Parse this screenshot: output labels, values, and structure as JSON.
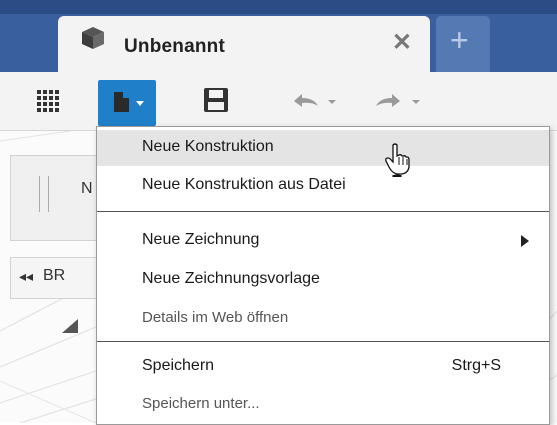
{
  "tab": {
    "title": "Unbenannt",
    "close_label": "✕",
    "icon": "cube-icon"
  },
  "new_tab": {
    "label": "+"
  },
  "toolbar": {
    "icons": [
      "apps-grid-icon",
      "file-menu-icon",
      "save-icon",
      "undo-icon",
      "redo-icon"
    ]
  },
  "workspace": {
    "panel_letter": "N",
    "nav_arrow": "◂◂",
    "nav_label": "BR"
  },
  "menu": {
    "items": [
      {
        "label": "Neue Konstruktion",
        "shortcut": "",
        "submenu": false,
        "hovered": true
      },
      {
        "label": "Neue Konstruktion aus Datei",
        "shortcut": "",
        "submenu": false
      },
      {
        "label": "Neue Zeichnung",
        "shortcut": "",
        "submenu": true
      },
      {
        "label": "Neue Zeichnungsvorlage",
        "shortcut": "",
        "submenu": false
      },
      {
        "label": "Details im Web öffnen",
        "shortcut": "",
        "submenu": false
      },
      {
        "label": "Speichern",
        "shortcut": "Strg+S",
        "submenu": false
      },
      {
        "label": "Speichern unter...",
        "shortcut": "",
        "submenu": false
      }
    ]
  },
  "colors": {
    "titlebar": "#3a5f9f",
    "file_button_active": "#1f7fc8",
    "menu_hover": "#e4e4e4"
  }
}
